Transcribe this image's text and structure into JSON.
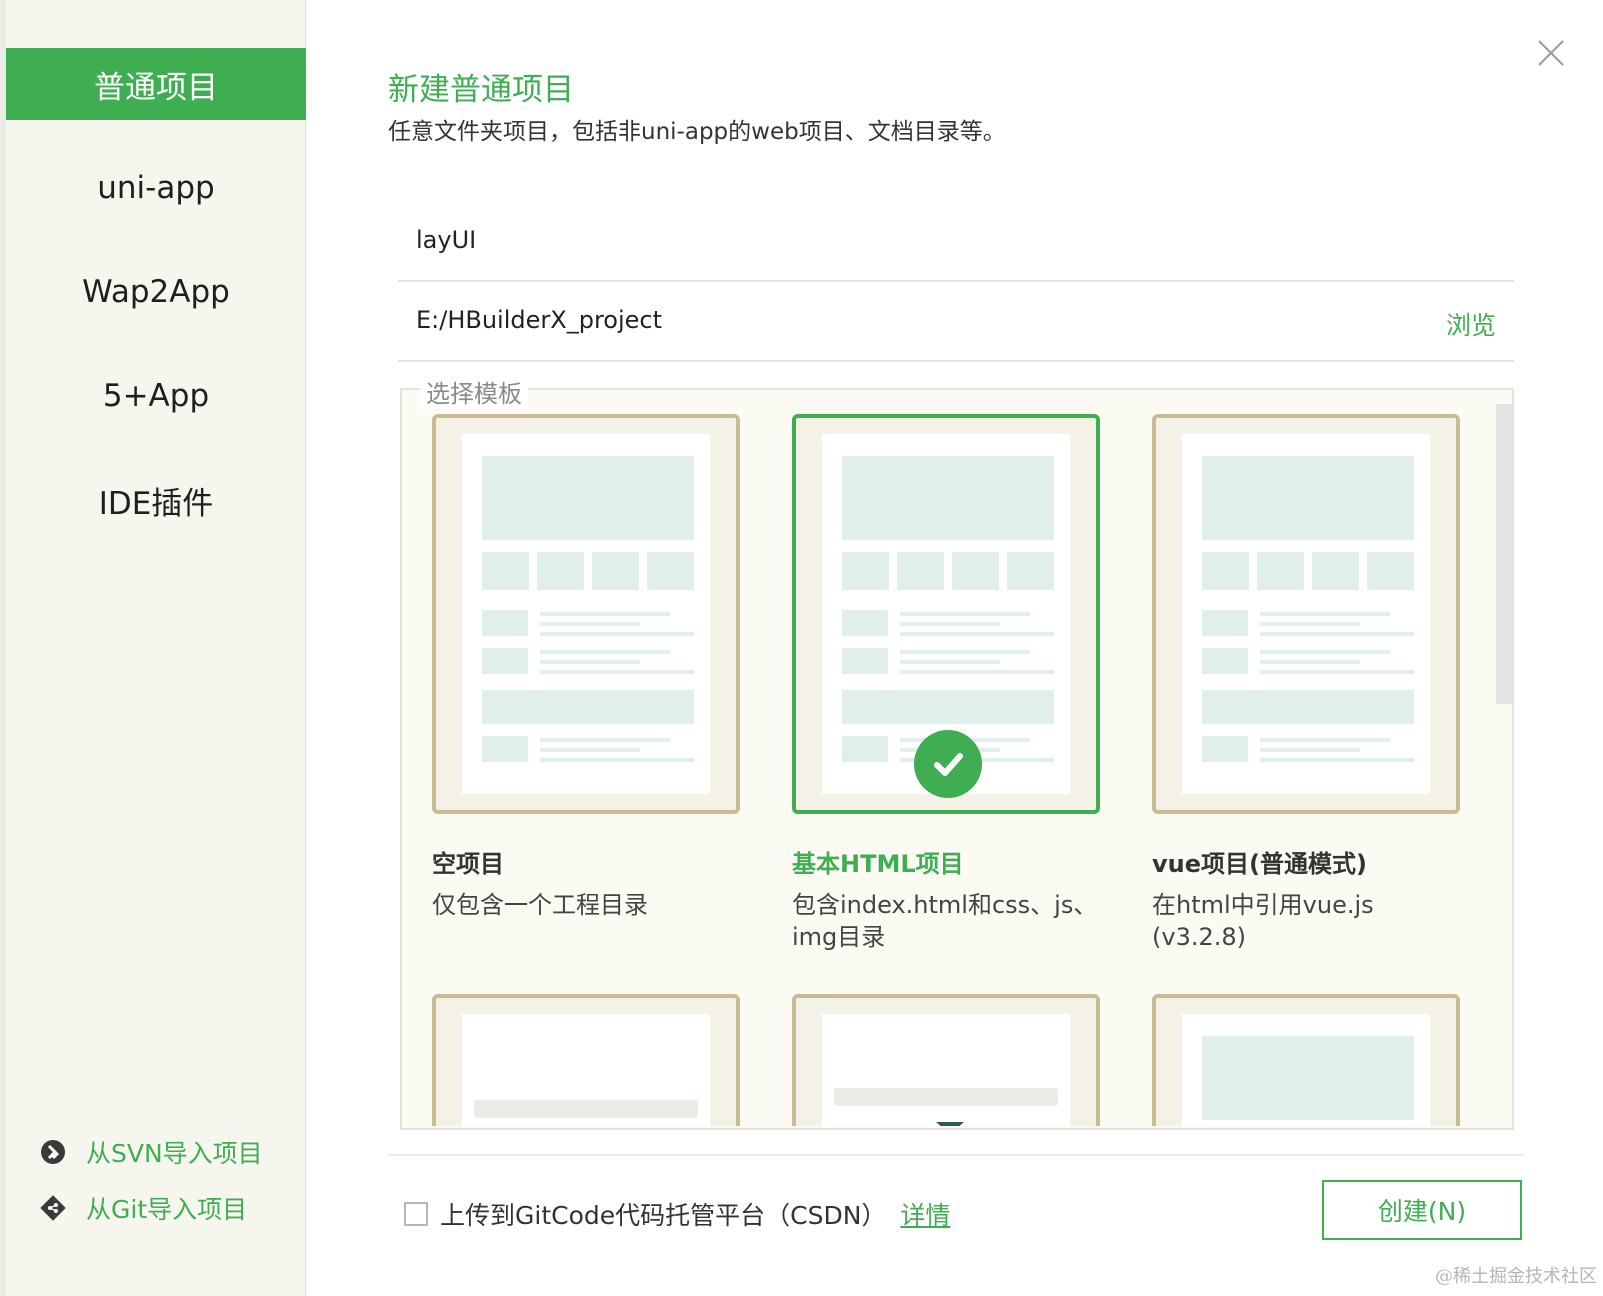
{
  "sidebar": {
    "items": [
      {
        "label": "普通项目",
        "active": true
      },
      {
        "label": "uni-app"
      },
      {
        "label": "Wap2App"
      },
      {
        "label": "5+App"
      },
      {
        "label": "IDE插件"
      }
    ],
    "import_svn": "从SVN导入项目",
    "import_git": "从Git导入项目"
  },
  "header": {
    "title": "新建普通项目",
    "subtitle": "任意文件夹项目，包括非uni-app的web项目、文档目录等。"
  },
  "form": {
    "project_name": "layUI",
    "project_path": "E:/HBuilderX_project",
    "browse_label": "浏览"
  },
  "templates": {
    "legend": "选择模板",
    "cards": [
      {
        "title": "空项目",
        "desc": "仅包含一个工程目录"
      },
      {
        "title": "基本HTML项目",
        "desc": "包含index.html和css、js、img目录",
        "selected": true
      },
      {
        "title": "vue项目(普通模式)",
        "desc": "在html中引用vue.js (v3.2.8)"
      }
    ]
  },
  "footer": {
    "upload_label": "上传到GitCode代码托管平台（CSDN）",
    "detail_label": "详情",
    "create_label": "创建(N)"
  },
  "watermark": "@稀土掘金技术社区",
  "colors": {
    "accent": "#3fae52",
    "sidebar_bg": "#f7f6ee",
    "card_border": "#c9bb92"
  }
}
